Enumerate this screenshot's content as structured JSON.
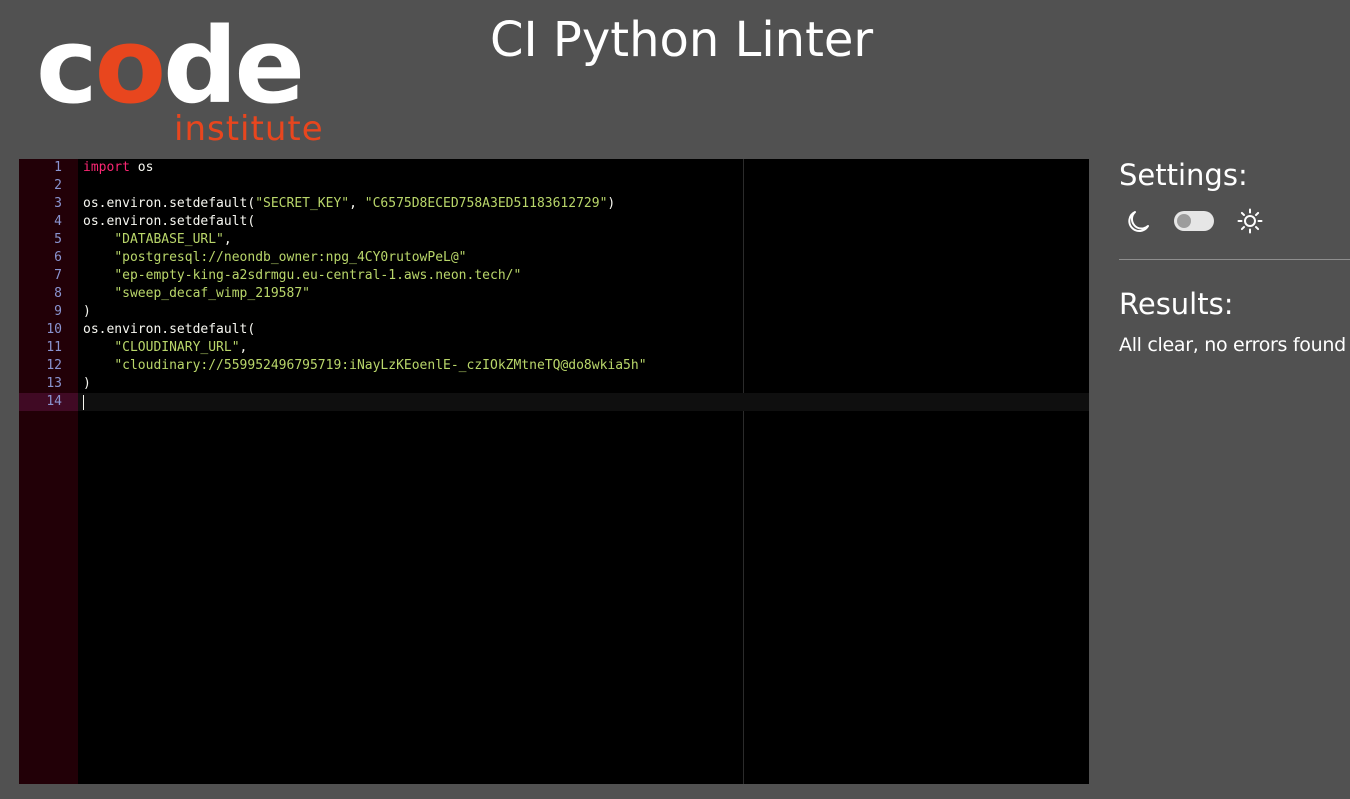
{
  "header": {
    "logo": {
      "word_prefix": "c",
      "word_accent": "o",
      "word_suffix": "de",
      "subtitle": "institute"
    },
    "title": "CI Python Linter"
  },
  "editor": {
    "active_line": 14,
    "lines": [
      {
        "n": "1",
        "tokens": [
          {
            "t": "kw",
            "v": "import"
          },
          {
            "t": "plain",
            "v": " os"
          }
        ]
      },
      {
        "n": "2",
        "tokens": []
      },
      {
        "n": "3",
        "tokens": [
          {
            "t": "plain",
            "v": "os.environ.setdefault("
          },
          {
            "t": "str",
            "v": "\"SECRET_KEY\""
          },
          {
            "t": "plain",
            "v": ", "
          },
          {
            "t": "str",
            "v": "\"C6575D8ECED758A3ED51183612729\""
          },
          {
            "t": "plain",
            "v": ")"
          }
        ]
      },
      {
        "n": "4",
        "tokens": [
          {
            "t": "plain",
            "v": "os.environ.setdefault("
          }
        ]
      },
      {
        "n": "5",
        "tokens": [
          {
            "t": "plain",
            "v": "    "
          },
          {
            "t": "str",
            "v": "\"DATABASE_URL\""
          },
          {
            "t": "plain",
            "v": ","
          }
        ]
      },
      {
        "n": "6",
        "tokens": [
          {
            "t": "plain",
            "v": "    "
          },
          {
            "t": "str",
            "v": "\"postgresql://neondb_owner:npg_4CY0rutowPeL@\""
          }
        ]
      },
      {
        "n": "7",
        "tokens": [
          {
            "t": "plain",
            "v": "    "
          },
          {
            "t": "str",
            "v": "\"ep-empty-king-a2sdrmgu.eu-central-1.aws.neon.tech/\""
          }
        ]
      },
      {
        "n": "8",
        "tokens": [
          {
            "t": "plain",
            "v": "    "
          },
          {
            "t": "str",
            "v": "\"sweep_decaf_wimp_219587\""
          }
        ]
      },
      {
        "n": "9",
        "tokens": [
          {
            "t": "plain",
            "v": ")"
          }
        ]
      },
      {
        "n": "10",
        "tokens": [
          {
            "t": "plain",
            "v": "os.environ.setdefault("
          }
        ]
      },
      {
        "n": "11",
        "tokens": [
          {
            "t": "plain",
            "v": "    "
          },
          {
            "t": "str",
            "v": "\"CLOUDINARY_URL\""
          },
          {
            "t": "plain",
            "v": ","
          }
        ]
      },
      {
        "n": "12",
        "tokens": [
          {
            "t": "plain",
            "v": "    "
          },
          {
            "t": "str",
            "v": "\"cloudinary://559952496795719:iNayLzKEoenlE-_czIOkZMtneTQ@do8wkia5h\""
          }
        ]
      },
      {
        "n": "13",
        "tokens": [
          {
            "t": "plain",
            "v": ")"
          }
        ]
      },
      {
        "n": "14",
        "tokens": []
      }
    ]
  },
  "settings": {
    "heading": "Settings:",
    "dark_mode_icon": "moon-icon",
    "light_mode_icon": "sun-icon",
    "theme_toggle_on": false
  },
  "results": {
    "heading": "Results:",
    "message": "All clear, no errors found"
  },
  "colors": {
    "background": "#515151",
    "accent": "#e8461e",
    "editor_bg": "#000000",
    "gutter_bg": "#220007",
    "keyword": "#f92672",
    "string": "#b9d66a",
    "line_number": "#8a94d0"
  }
}
